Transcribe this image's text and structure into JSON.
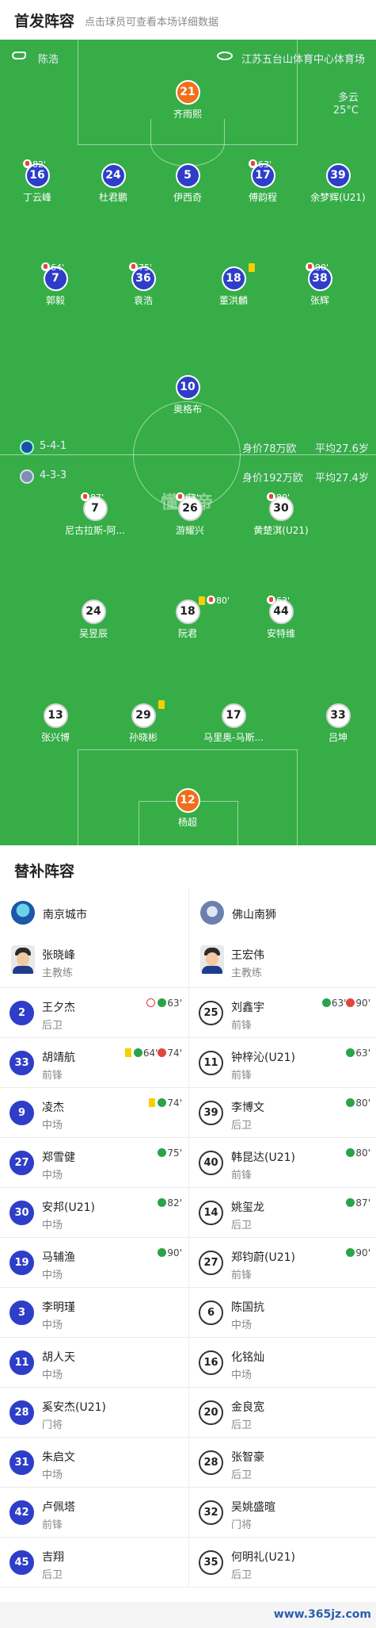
{
  "header": {
    "title": "首发阵容",
    "subtitle": "点击球员可查看本场详细数据"
  },
  "field": {
    "referee": "陈浩",
    "stadium": "江苏五台山体育中心体育场",
    "weather": "多云",
    "temperature": "25°C",
    "watermark": "懂球帝",
    "home_formation": "5-4-1",
    "home_value": "身价78万欧",
    "home_age": "平均27.6岁",
    "away_formation": "4-3-3",
    "away_value": "身价192万欧",
    "away_age": "平均27.4岁"
  },
  "home_players": [
    {
      "num": "21",
      "name": "齐雨熙",
      "gk": true
    },
    {
      "num": "16",
      "name": "丁云峰",
      "sub": "82'"
    },
    {
      "num": "24",
      "name": "杜君鹏"
    },
    {
      "num": "5",
      "name": "伊西奇"
    },
    {
      "num": "17",
      "name": "傅韵程",
      "sub": "63'"
    },
    {
      "num": "39",
      "name": "余梦辉(U21)"
    },
    {
      "num": "7",
      "name": "郭毅",
      "sub": "64'",
      "goal": true
    },
    {
      "num": "36",
      "name": "袁浩",
      "sub": "75'"
    },
    {
      "num": "18",
      "name": "董洪麟",
      "captain": true,
      "yellow": true
    },
    {
      "num": "38",
      "name": "张辉",
      "sub": "90'"
    },
    {
      "num": "10",
      "name": "奥格布"
    }
  ],
  "away_players": [
    {
      "num": "7",
      "name": "尼古拉斯-阿...",
      "sub": "87'"
    },
    {
      "num": "26",
      "name": "游耀兴",
      "sub": "63'"
    },
    {
      "num": "30",
      "name": "黄楚淇(U21)",
      "sub": "80'"
    },
    {
      "num": "24",
      "name": "吴昱辰"
    },
    {
      "num": "18",
      "name": "阮君",
      "sub": "80'",
      "yellow": true
    },
    {
      "num": "44",
      "name": "安特维",
      "sub": "63'"
    },
    {
      "num": "13",
      "name": "张兴博"
    },
    {
      "num": "29",
      "name": "孙晓彬",
      "yellow": true
    },
    {
      "num": "17",
      "name": "马里奥-马斯..."
    },
    {
      "num": "33",
      "name": "吕坤"
    },
    {
      "num": "12",
      "name": "杨超",
      "gk": true,
      "captain": true
    }
  ],
  "subs": {
    "title": "替补阵容",
    "home": {
      "team": "南京城市",
      "coach": {
        "name": "张晓峰",
        "role": "主教练"
      },
      "players": [
        {
          "num": "2",
          "name": "王夕杰",
          "pos": "后卫",
          "events": [
            {
              "t": "pk"
            },
            {
              "t": "in",
              "m": "63'"
            }
          ]
        },
        {
          "num": "33",
          "name": "胡靖航",
          "pos": "前锋",
          "events": [
            {
              "t": "y"
            },
            {
              "t": "in",
              "m": "64'"
            },
            {
              "t": "out",
              "m": "74'"
            }
          ]
        },
        {
          "num": "9",
          "name": "凌杰",
          "pos": "中场",
          "events": [
            {
              "t": "y"
            },
            {
              "t": "in",
              "m": "74'"
            }
          ]
        },
        {
          "num": "27",
          "name": "郑雪健",
          "pos": "中场",
          "events": [
            {
              "t": "in",
              "m": "75'"
            }
          ]
        },
        {
          "num": "30",
          "name": "安邦(U21)",
          "pos": "中场",
          "events": [
            {
              "t": "in",
              "m": "82'"
            }
          ]
        },
        {
          "num": "19",
          "name": "马辅渔",
          "pos": "中场",
          "events": [
            {
              "t": "in",
              "m": "90'"
            }
          ]
        },
        {
          "num": "3",
          "name": "李明瑾",
          "pos": "中场",
          "events": []
        },
        {
          "num": "11",
          "name": "胡人天",
          "pos": "中场",
          "events": []
        },
        {
          "num": "28",
          "name": "奚安杰(U21)",
          "pos": "门将",
          "events": []
        },
        {
          "num": "31",
          "name": "朱启文",
          "pos": "中场",
          "events": []
        },
        {
          "num": "42",
          "name": "卢佩塔",
          "pos": "前锋",
          "events": []
        },
        {
          "num": "45",
          "name": "吉翔",
          "pos": "后卫",
          "events": []
        }
      ]
    },
    "away": {
      "team": "佛山南狮",
      "coach": {
        "name": "王宏伟",
        "role": "主教练"
      },
      "players": [
        {
          "num": "25",
          "name": "刘鑫宇",
          "pos": "前锋",
          "events": [
            {
              "t": "in",
              "m": "63'"
            },
            {
              "t": "out",
              "m": "90'"
            }
          ]
        },
        {
          "num": "11",
          "name": "钟梓沁(U21)",
          "pos": "前锋",
          "events": [
            {
              "t": "in",
              "m": "63'"
            }
          ]
        },
        {
          "num": "39",
          "name": "李博文",
          "pos": "后卫",
          "events": [
            {
              "t": "in",
              "m": "80'"
            }
          ]
        },
        {
          "num": "40",
          "name": "韩昆达(U21)",
          "pos": "前锋",
          "events": [
            {
              "t": "in",
              "m": "80'"
            }
          ]
        },
        {
          "num": "14",
          "name": "姚玺龙",
          "pos": "后卫",
          "events": [
            {
              "t": "in",
              "m": "87'"
            }
          ]
        },
        {
          "num": "27",
          "name": "郑钧蔚(U21)",
          "pos": "前锋",
          "events": [
            {
              "t": "in",
              "m": "90'"
            }
          ]
        },
        {
          "num": "6",
          "name": "陈国抗",
          "pos": "中场",
          "events": []
        },
        {
          "num": "16",
          "name": "化铭灿",
          "pos": "中场",
          "events": []
        },
        {
          "num": "20",
          "name": "金良宽",
          "pos": "后卫",
          "events": []
        },
        {
          "num": "28",
          "name": "张智豪",
          "pos": "后卫",
          "events": []
        },
        {
          "num": "32",
          "name": "吴姚盛暄",
          "pos": "门将",
          "events": []
        },
        {
          "num": "35",
          "name": "何明礼(U21)",
          "pos": "后卫",
          "events": []
        }
      ]
    }
  },
  "footer": {
    "text": "www.365jz.com"
  }
}
